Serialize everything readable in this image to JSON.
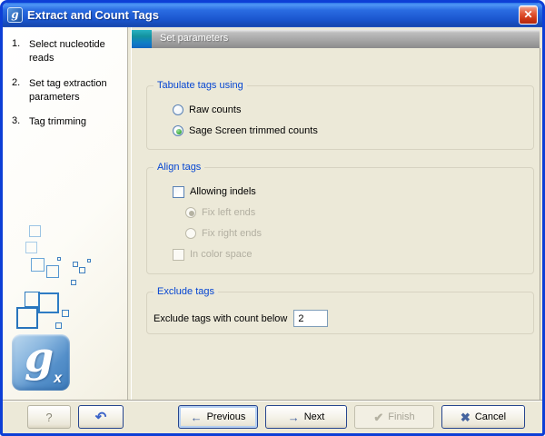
{
  "window": {
    "title": "Extract and Count Tags",
    "app_icon_letter": "g",
    "close_glyph": "✕"
  },
  "sidebar": {
    "steps": [
      {
        "number": "1.",
        "label": "Select nucleotide reads"
      },
      {
        "number": "2.",
        "label": "Set tag extraction parameters"
      },
      {
        "number": "3.",
        "label": "Tag trimming"
      }
    ],
    "logo": {
      "main": "g",
      "sub": "x"
    }
  },
  "header": {
    "title": "Set parameters"
  },
  "form": {
    "tabulate": {
      "title": "Tabulate tags using",
      "options": [
        {
          "label": "Raw counts",
          "selected": false
        },
        {
          "label": "Sage Screen trimmed counts",
          "selected": true
        }
      ]
    },
    "align": {
      "title": "Align tags",
      "allowing_indels": {
        "label": "Allowing indels",
        "checked": false
      },
      "options": [
        {
          "label": "Fix left ends",
          "selected": true,
          "enabled": false
        },
        {
          "label": "Fix right ends",
          "selected": false,
          "enabled": false
        }
      ],
      "in_color_space": {
        "label": "In color space",
        "checked": false,
        "enabled": false
      }
    },
    "exclude": {
      "title": "Exclude tags",
      "label": "Exclude tags with count below",
      "value": "2"
    }
  },
  "footer": {
    "help_label": "?",
    "undo_glyph": "↶",
    "previous_label": "Previous",
    "next_label": "Next",
    "finish_label": "Finish",
    "cancel_label": "Cancel",
    "previous_icon": "←",
    "next_icon": "→",
    "finish_icon": "✔",
    "cancel_icon": "✖"
  },
  "colors": {
    "titlebar_blue": "#1a55cd",
    "window_border": "#0d3fd6",
    "panel_beige": "#ece9d8",
    "groupbox_title_blue": "#0646d2",
    "radio_selected_green": "#37a837",
    "header_square_teal": "#13a0c0"
  }
}
